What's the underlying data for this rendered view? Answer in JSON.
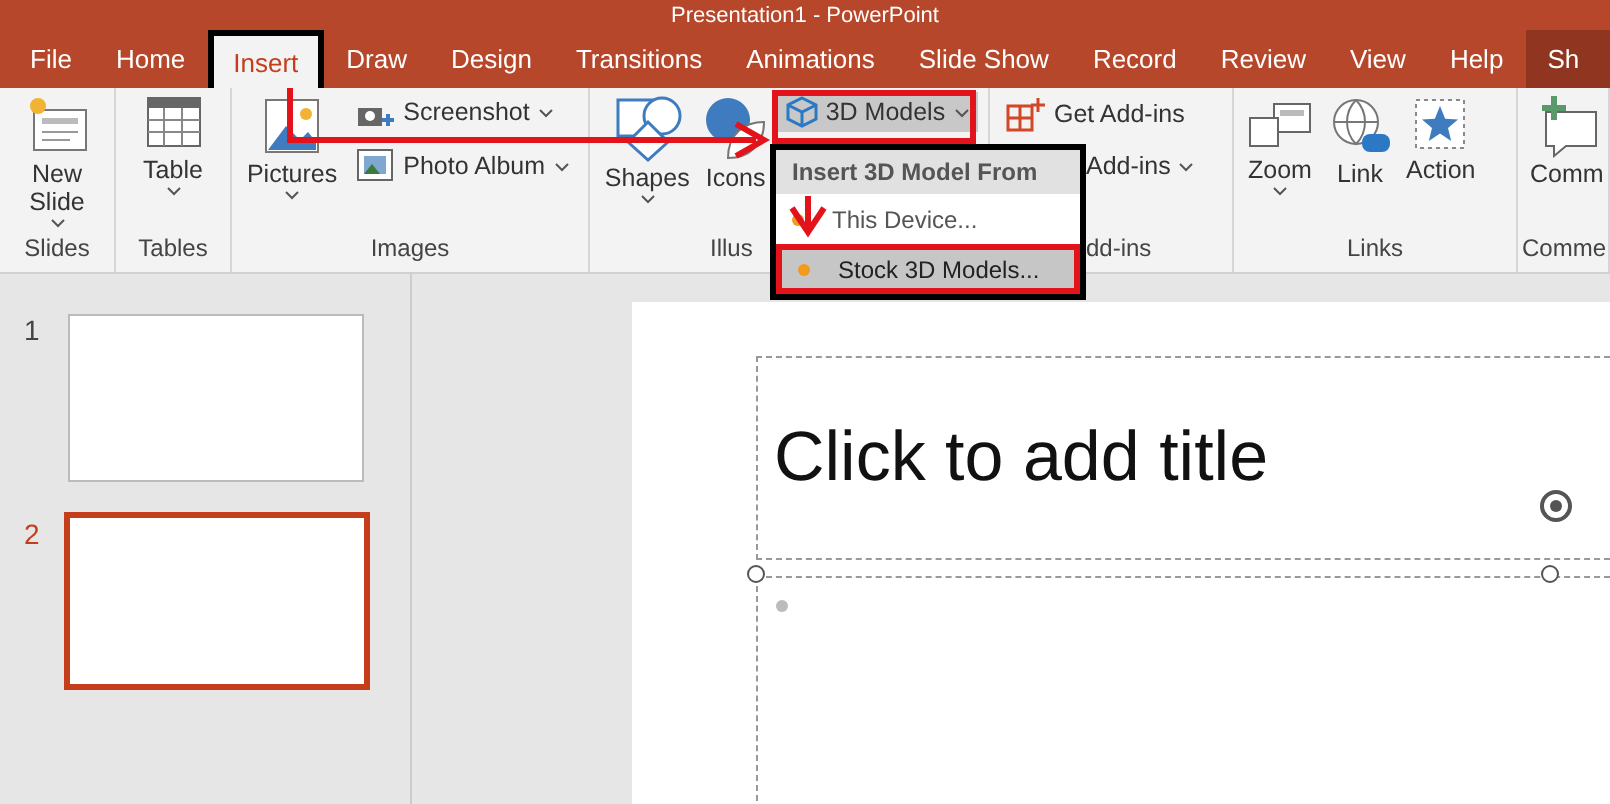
{
  "window": {
    "title": "Presentation1 - PowerPoint"
  },
  "tabs": [
    {
      "label": "File",
      "selected": false
    },
    {
      "label": "Home",
      "selected": false
    },
    {
      "label": "Insert",
      "selected": true
    },
    {
      "label": "Draw",
      "selected": false
    },
    {
      "label": "Design",
      "selected": false
    },
    {
      "label": "Transitions",
      "selected": false
    },
    {
      "label": "Animations",
      "selected": false
    },
    {
      "label": "Slide Show",
      "selected": false
    },
    {
      "label": "Record",
      "selected": false
    },
    {
      "label": "Review",
      "selected": false
    },
    {
      "label": "View",
      "selected": false
    },
    {
      "label": "Help",
      "selected": false
    },
    {
      "label": "Sh",
      "selected": false
    }
  ],
  "ribbon": {
    "groups": [
      {
        "label": "Slides",
        "commands": [
          {
            "label": "New Slide",
            "kind": "large",
            "dropdown": true
          }
        ]
      },
      {
        "label": "Tables",
        "commands": [
          {
            "label": "Table",
            "kind": "large",
            "dropdown": true
          }
        ]
      },
      {
        "label": "Images",
        "commands": [
          {
            "label": "Pictures",
            "kind": "large",
            "dropdown": true
          },
          {
            "label": "Screenshot",
            "kind": "small",
            "dropdown": true
          },
          {
            "label": "Photo Album",
            "kind": "small",
            "dropdown": true
          }
        ]
      },
      {
        "label": "Illus",
        "commands": [
          {
            "label": "Shapes",
            "kind": "large",
            "dropdown": true
          },
          {
            "label": "Icons",
            "kind": "large",
            "dropdown": false
          },
          {
            "label": "3D Models",
            "kind": "small",
            "dropdown": true
          }
        ]
      },
      {
        "label": "dd-ins",
        "commands": [
          {
            "label": "Get Add-ins",
            "kind": "small",
            "dropdown": false
          },
          {
            "label": "Add-ins",
            "kind": "small",
            "dropdown": true
          }
        ]
      },
      {
        "label": "Links",
        "commands": [
          {
            "label": "Zoom",
            "kind": "large",
            "dropdown": true
          },
          {
            "label": "Link",
            "kind": "large",
            "dropdown": false
          },
          {
            "label": "Action",
            "kind": "large",
            "dropdown": false
          }
        ]
      },
      {
        "label": "Comme",
        "commands": [
          {
            "label": "Comm",
            "kind": "large",
            "dropdown": false
          }
        ]
      }
    ]
  },
  "menu": {
    "header": "Insert 3D Model From",
    "items": [
      {
        "label": "This Device...",
        "selected": false
      },
      {
        "label": "Stock 3D Models...",
        "selected": true
      }
    ]
  },
  "thumbnails": [
    {
      "number": "1",
      "selected": false
    },
    {
      "number": "2",
      "selected": true
    }
  ],
  "slide": {
    "title_placeholder": "Click to add title"
  }
}
